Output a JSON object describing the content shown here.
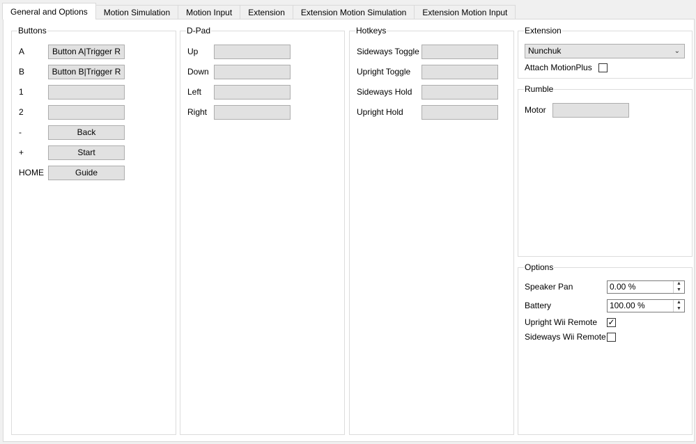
{
  "tabs": [
    {
      "label": "General and Options",
      "active": true
    },
    {
      "label": "Motion Simulation"
    },
    {
      "label": "Motion Input"
    },
    {
      "label": "Extension"
    },
    {
      "label": "Extension Motion Simulation"
    },
    {
      "label": "Extension Motion Input"
    }
  ],
  "buttons": {
    "title": "Buttons",
    "rows": [
      {
        "label": "A",
        "value": "Button A|Trigger R"
      },
      {
        "label": "B",
        "value": "Button B|Trigger R"
      },
      {
        "label": "1",
        "value": ""
      },
      {
        "label": "2",
        "value": ""
      },
      {
        "label": "-",
        "value": "Back"
      },
      {
        "label": "+",
        "value": "Start"
      },
      {
        "label": "HOME",
        "value": "Guide"
      }
    ]
  },
  "dpad": {
    "title": "D-Pad",
    "rows": [
      {
        "label": "Up",
        "value": ""
      },
      {
        "label": "Down",
        "value": ""
      },
      {
        "label": "Left",
        "value": ""
      },
      {
        "label": "Right",
        "value": ""
      }
    ]
  },
  "hotkeys": {
    "title": "Hotkeys",
    "rows": [
      {
        "label": "Sideways Toggle",
        "value": ""
      },
      {
        "label": "Upright Toggle",
        "value": ""
      },
      {
        "label": "Sideways Hold",
        "value": ""
      },
      {
        "label": "Upright Hold",
        "value": ""
      }
    ]
  },
  "extension": {
    "title": "Extension",
    "selected": "Nunchuk",
    "attach_label": "Attach MotionPlus",
    "attach_checked": false
  },
  "rumble": {
    "title": "Rumble",
    "motor_label": "Motor",
    "motor_value": ""
  },
  "options": {
    "title": "Options",
    "speaker_pan_label": "Speaker Pan",
    "speaker_pan_value": "0.00 %",
    "battery_label": "Battery",
    "battery_value": "100.00 %",
    "upright_label": "Upright Wii Remote",
    "upright_checked": true,
    "sideways_label": "Sideways Wii Remote",
    "sideways_checked": false
  },
  "icons": {
    "chevron": "chevron-down-icon",
    "spin_up": "spin-up-icon",
    "spin_down": "spin-down-icon",
    "checkmark": "checkmark-icon"
  }
}
